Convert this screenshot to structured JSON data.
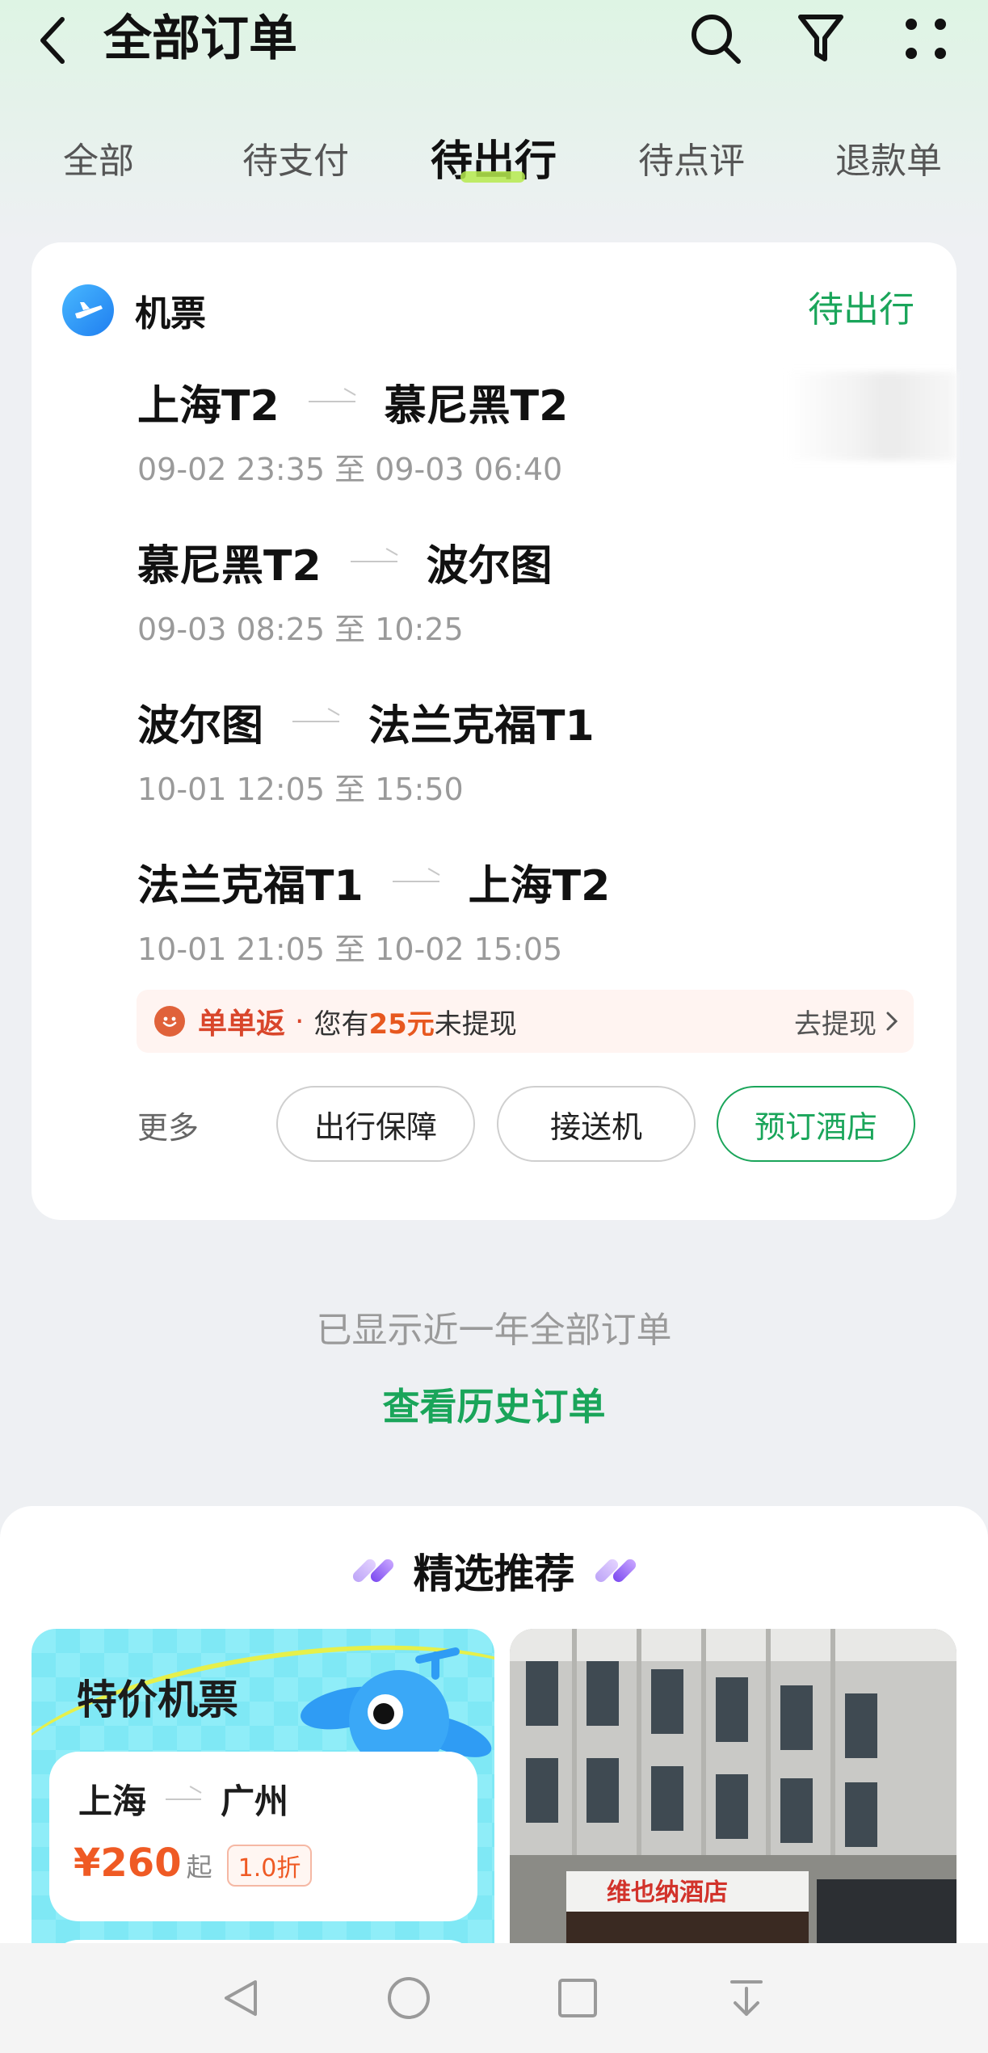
{
  "header": {
    "title": "全部订单",
    "icons": [
      "chevron-left-icon",
      "search-icon",
      "filter-icon",
      "more-grid-icon"
    ]
  },
  "tabs": [
    {
      "label": "全部",
      "active": false
    },
    {
      "label": "待支付",
      "active": false
    },
    {
      "label": "待出行",
      "active": true
    },
    {
      "label": "待点评",
      "active": false
    },
    {
      "label": "退款单",
      "active": false
    }
  ],
  "order": {
    "category": "机票",
    "status": "待出行",
    "segments": [
      {
        "from": "上海T2",
        "to": "慕尼黑T2",
        "time": "09-02 23:35 至 09-03 06:40"
      },
      {
        "from": "慕尼黑T2",
        "to": "波尔图",
        "time": "09-03 08:25 至 10:25"
      },
      {
        "from": "波尔图",
        "to": "法兰克福T1",
        "time": "10-01 12:05 至 15:50"
      },
      {
        "from": "法兰克福T1",
        "to": "上海T2",
        "time": "10-01 21:05 至 10-02 15:05"
      }
    ],
    "cashback": {
      "title": "单单返",
      "dot": "·",
      "prefix": "您有",
      "amount": "25元",
      "suffix": "未提现",
      "action": "去提现"
    },
    "more_label": "更多",
    "actions": [
      "出行保障",
      "接送机",
      "预订酒店"
    ]
  },
  "history": {
    "note": "已显示近一年全部订单",
    "link": "查看历史订单"
  },
  "recommend": {
    "title": "精选推荐",
    "deal": {
      "title": "特价机票",
      "from": "上海",
      "to": "广州",
      "price": "¥260",
      "price_suffix": "起",
      "discount": "1.0折"
    },
    "hotel_sign": "维也纳酒店"
  },
  "colors": {
    "accent_green": "#1aa55a",
    "price_orange": "#ef5a24",
    "cashback_red": "#d9462b"
  }
}
